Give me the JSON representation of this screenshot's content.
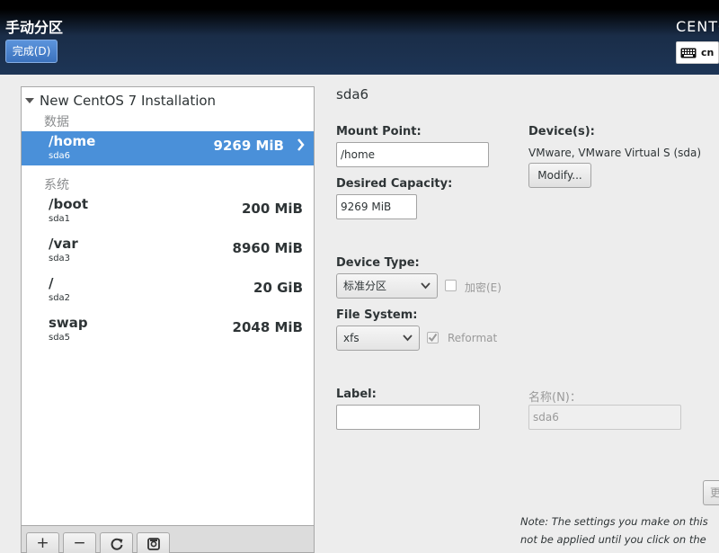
{
  "header": {
    "title": "手动分区",
    "done_label": "完成(D)",
    "product": "CENTOS",
    "keyboard_layout": "cn"
  },
  "mount_points": {
    "install_title": "New CentOS 7 Installation",
    "groups": [
      {
        "label": "数据",
        "items": [
          {
            "name": "/home",
            "device": "sda6",
            "size": "9269 MiB",
            "selected": true
          }
        ]
      },
      {
        "label": "系统",
        "items": [
          {
            "name": "/boot",
            "device": "sda1",
            "size": "200 MiB",
            "selected": false
          },
          {
            "name": "/var",
            "device": "sda3",
            "size": "8960 MiB",
            "selected": false
          },
          {
            "name": "/",
            "device": "sda2",
            "size": "20 GiB",
            "selected": false
          },
          {
            "name": "swap",
            "device": "sda5",
            "size": "2048 MiB",
            "selected": false
          }
        ]
      }
    ],
    "toolbar": {
      "add": "+",
      "remove": "−",
      "refresh_icon": "refresh-icon",
      "configure_icon": "disk-config-icon"
    }
  },
  "details": {
    "section_title": "sda6",
    "mount_point_label": "Mount Point:",
    "mount_point_value": "/home",
    "desired_capacity_label": "Desired Capacity:",
    "desired_capacity_value": "9269 MiB",
    "devices_label": "Device(s):",
    "devices_value": "VMware, VMware Virtual S (sda)",
    "modify_label": "Modify...",
    "device_type_label": "Device Type:",
    "device_type_value": "标准分区",
    "encrypt_label": "加密(E)",
    "encrypt_checked": false,
    "file_system_label": "File System:",
    "file_system_value": "xfs",
    "reformat_label": "Reformat",
    "reformat_checked": true,
    "label_label": "Label:",
    "label_value": "",
    "name_label": "名称(N)：",
    "name_value": "sda6",
    "update_button_partial": "更",
    "note_line1": "Note:  The settings you make on this",
    "note_line2": "not be applied until you click on the"
  },
  "colors": {
    "selected_row": "#4a90d9",
    "top_bar": "#1d3556",
    "done_button": "#4a84cf"
  }
}
